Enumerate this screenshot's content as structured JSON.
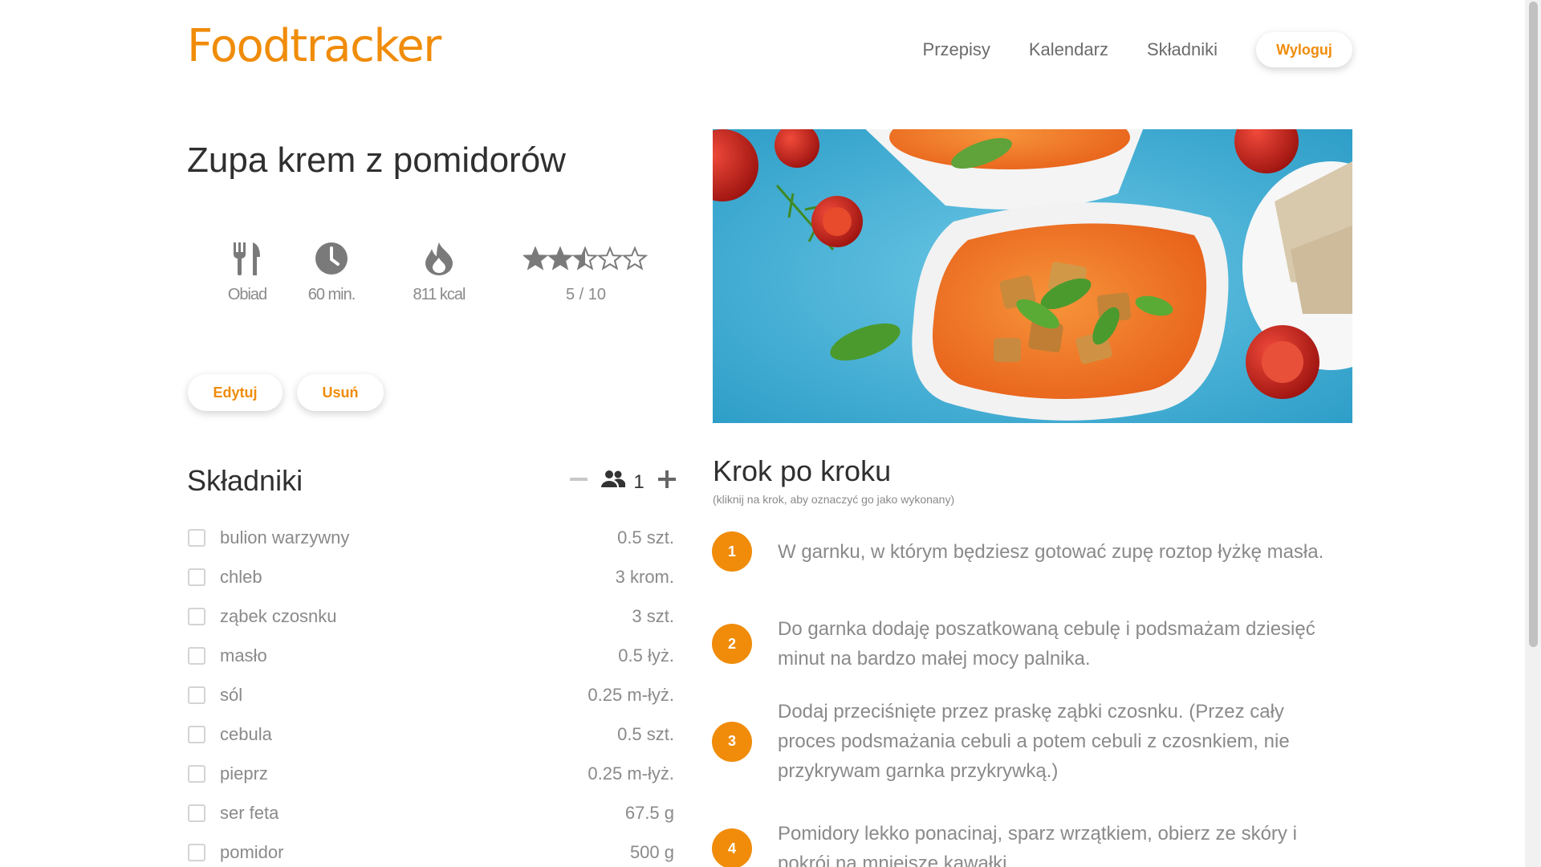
{
  "app": {
    "logo": "Foodtracker",
    "brand_color": "#f08c0a"
  },
  "nav": {
    "items": [
      "Przepisy",
      "Kalendarz",
      "Składniki"
    ],
    "logout_label": "Wyloguj"
  },
  "recipe": {
    "title": "Zupa krem z pomidorów",
    "category": "Obiad",
    "time": "60 min.",
    "calories": "811 kcal",
    "rating_text": "5 / 10",
    "rating_value": 5,
    "rating_max": 10,
    "edit_label": "Edytuj",
    "delete_label": "Usuń"
  },
  "ingredients": {
    "heading": "Składniki",
    "servings": "1",
    "items": [
      {
        "name": "bulion warzywny",
        "amount": "0.5 szt."
      },
      {
        "name": "chleb",
        "amount": "3 krom."
      },
      {
        "name": "ząbek czosnku",
        "amount": "3 szt."
      },
      {
        "name": "masło",
        "amount": "0.5 łyż."
      },
      {
        "name": "sól",
        "amount": "0.25 m-łyż."
      },
      {
        "name": "cebula",
        "amount": "0.5 szt."
      },
      {
        "name": "pieprz",
        "amount": "0.25 m-łyż."
      },
      {
        "name": "ser feta",
        "amount": "67.5 g"
      },
      {
        "name": "pomidor",
        "amount": "500 g"
      }
    ]
  },
  "steps": {
    "heading": "Krok po kroku",
    "hint": "(kliknij na krok, aby oznaczyć go jako wykonany)",
    "items": [
      {
        "num": "1",
        "text": "W garnku, w którym będziesz gotować zupę roztop łyżkę masła."
      },
      {
        "num": "2",
        "text": "Do garnka dodaję poszatkowaną cebulę i podsmażam dziesięć minut na bardzo małej mocy palnika."
      },
      {
        "num": "3",
        "text": "Dodaj przeciśnięte przez praskę ząbki czosnku. (Przez cały proces podsmażania cebuli a potem cebuli z czosnkiem, nie przykrywam garnka przykrywką.)"
      },
      {
        "num": "4",
        "text": "Pomidory lekko ponacinaj, sparz wrzątkiem, obierz ze skóry i pokrój na mniejsze kawałki"
      }
    ]
  }
}
